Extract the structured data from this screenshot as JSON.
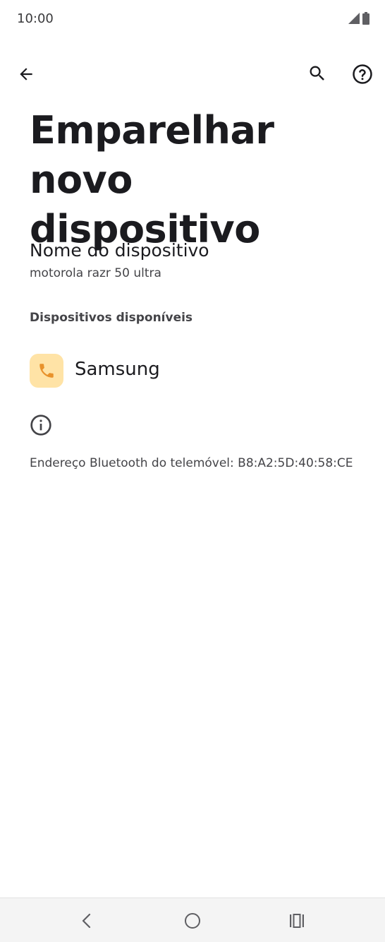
{
  "status_bar": {
    "time": "10:00",
    "icons": [
      "signal-icon",
      "battery-icon"
    ]
  },
  "top_bar": {
    "back_icon": "arrow-back-icon",
    "search_icon": "search-icon",
    "help_icon": "help-circle-icon"
  },
  "page": {
    "title": "Emparelhar novo dispositivo"
  },
  "device_name": {
    "title": "Nome do dispositivo",
    "value": "motorola razr 50 ultra"
  },
  "available_devices": {
    "header": "Dispositivos disponíveis",
    "items": [
      {
        "label": "Samsung",
        "icon": "phone-icon",
        "icon_bg": "#ffe3a6",
        "icon_color": "#e8922b"
      }
    ]
  },
  "info": {
    "icon": "info-icon",
    "bluetooth_address": "Endereço Bluetooth do telemóvel: B8:A2:5D:40:58:CE"
  },
  "nav_bar": {
    "buttons": [
      "nav-back-icon",
      "nav-home-icon",
      "nav-recents-icon"
    ]
  }
}
